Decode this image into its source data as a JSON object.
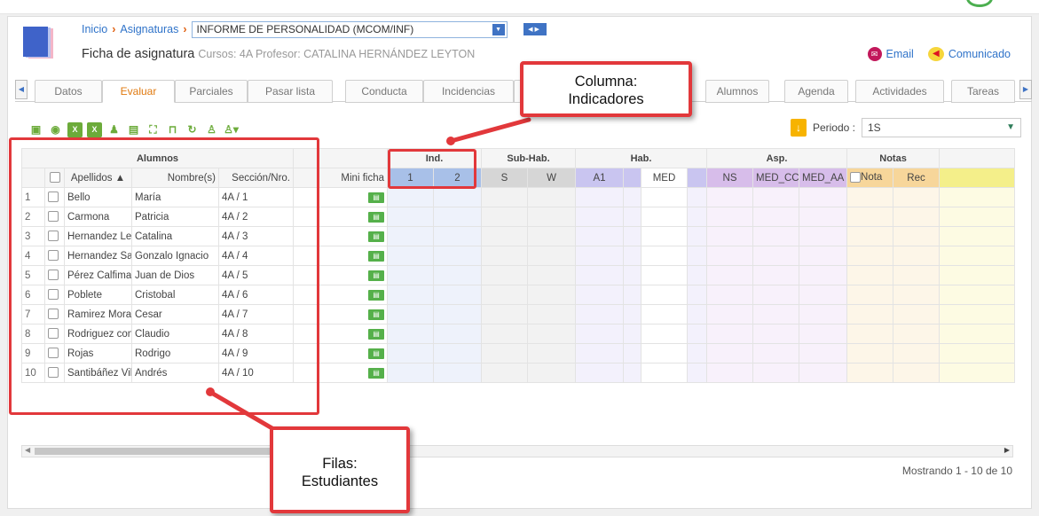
{
  "breadcrumb": {
    "home": "Inicio",
    "section": "Asignaturas",
    "subject": "INFORME DE PERSONALIDAD (MCOM/INF)"
  },
  "header": {
    "title": "Ficha de asignatura",
    "meta": "Cursos: 4A Profesor: CATALINA HERNÁNDEZ LEYTON"
  },
  "actions": {
    "email": "Email",
    "announce": "Comunicado"
  },
  "tabs": [
    {
      "label": "Datos",
      "active": false
    },
    {
      "label": "Evaluar",
      "active": true
    },
    {
      "label": "Parciales",
      "active": false
    },
    {
      "label": "Pasar lista",
      "active": false
    },
    {
      "label": "Conducta",
      "active": false
    },
    {
      "label": "Incidencias",
      "active": false
    },
    {
      "label": "Alumnos",
      "active": false
    },
    {
      "label": "Agenda",
      "active": false
    },
    {
      "label": "Actividades",
      "active": false
    },
    {
      "label": "Tareas",
      "active": false
    }
  ],
  "period": {
    "label": "Periodo :",
    "value": "1S"
  },
  "grid": {
    "groups": {
      "students": "Alumnos",
      "ind": "Ind.",
      "sub": "Sub-Hab.",
      "hab": "Hab.",
      "asp": "Asp.",
      "notas": "Notas"
    },
    "columns": {
      "apellidos": "Apellidos ▲",
      "nombres": "Nombre(s)",
      "seccion": "Sección/Nro.",
      "mini": "Mini ficha",
      "ind1": "1",
      "ind2": "2",
      "subS": "S",
      "subW": "W",
      "habA1": "A1",
      "habMED": "MED",
      "aspNS": "NS",
      "aspMEDCC": "MED_CC",
      "aspMEDAA": "MED_AA",
      "nota": "Nota",
      "rec": "Rec"
    },
    "rows": [
      {
        "n": "1",
        "apellidos": "Bello",
        "nombres": "María",
        "seccion": "4A / 1"
      },
      {
        "n": "2",
        "apellidos": "Carmona",
        "nombres": "Patricia",
        "seccion": "4A / 2"
      },
      {
        "n": "3",
        "apellidos": "Hernandez Leytc",
        "nombres": "Catalina",
        "seccion": "4A / 3"
      },
      {
        "n": "4",
        "apellidos": "Hernandez Sanh",
        "nombres": "Gonzalo Ignacio",
        "seccion": "4A / 4"
      },
      {
        "n": "5",
        "apellidos": "Pérez Calfiman",
        "nombres": "Juan de Dios",
        "seccion": "4A / 5"
      },
      {
        "n": "6",
        "apellidos": "Poblete",
        "nombres": "Cristobal",
        "seccion": "4A / 6"
      },
      {
        "n": "7",
        "apellidos": "Ramirez Morales",
        "nombres": "Cesar",
        "seccion": "4A / 7"
      },
      {
        "n": "8",
        "apellidos": "Rodriguez coneje",
        "nombres": "Claudio",
        "seccion": "4A / 8"
      },
      {
        "n": "9",
        "apellidos": "Rojas",
        "nombres": "Rodrigo",
        "seccion": "4A / 9"
      },
      {
        "n": "10",
        "apellidos": "Santibáñez Villal",
        "nombres": "Andrés",
        "seccion": "4A / 10"
      }
    ]
  },
  "footer": {
    "showing": "Mostrando 1 - 10 de 10"
  },
  "annotations": {
    "columns_line1": "Columna:",
    "columns_line2": "Indicadores",
    "rows_line1": "Filas:",
    "rows_line2": "Estudiantes"
  },
  "colors": {
    "accent": "#e07a10",
    "link": "#2f73c9",
    "annotation": "#e2383b"
  }
}
